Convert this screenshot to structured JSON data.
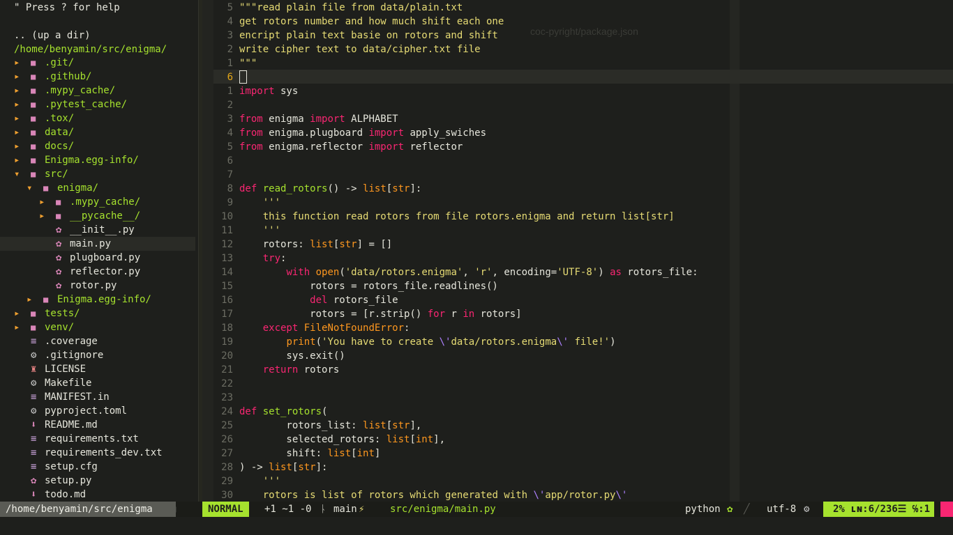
{
  "tree": {
    "help": "\" Press ? for help",
    "updir": ".. (up a dir)",
    "root": "/home/benyamin/src/enigma/",
    "items": [
      {
        "indent": 0,
        "kind": "dir",
        "arrow": "▸",
        "name": ".git/"
      },
      {
        "indent": 0,
        "kind": "dir",
        "arrow": "▸",
        "name": ".github/"
      },
      {
        "indent": 0,
        "kind": "dir",
        "arrow": "▸",
        "name": ".mypy_cache/"
      },
      {
        "indent": 0,
        "kind": "dir",
        "arrow": "▸",
        "name": ".pytest_cache/"
      },
      {
        "indent": 0,
        "kind": "dir",
        "arrow": "▸",
        "name": ".tox/"
      },
      {
        "indent": 0,
        "kind": "dir",
        "arrow": "▸",
        "name": "data/"
      },
      {
        "indent": 0,
        "kind": "dir",
        "arrow": "▸",
        "name": "docs/"
      },
      {
        "indent": 0,
        "kind": "dir",
        "arrow": "▸",
        "name": "Enigma.egg-info/"
      },
      {
        "indent": 0,
        "kind": "dir",
        "arrow": "▾",
        "name": "src/"
      },
      {
        "indent": 1,
        "kind": "dir",
        "arrow": "▾",
        "name": "enigma/"
      },
      {
        "indent": 2,
        "kind": "dir",
        "arrow": "▸",
        "name": ".mypy_cache/"
      },
      {
        "indent": 2,
        "kind": "dir",
        "arrow": "▸",
        "name": "__pycache__/"
      },
      {
        "indent": 2,
        "kind": "py",
        "name": "__init__.py"
      },
      {
        "indent": 2,
        "kind": "py",
        "name": "main.py",
        "current": true
      },
      {
        "indent": 2,
        "kind": "py",
        "name": "plugboard.py"
      },
      {
        "indent": 2,
        "kind": "py",
        "name": "reflector.py"
      },
      {
        "indent": 2,
        "kind": "py",
        "name": "rotor.py"
      },
      {
        "indent": 1,
        "kind": "dir",
        "arrow": "▸",
        "name": "Enigma.egg-info/"
      },
      {
        "indent": 0,
        "kind": "dir",
        "arrow": "▸",
        "name": "tests/"
      },
      {
        "indent": 0,
        "kind": "dir",
        "arrow": "▸",
        "name": "venv/"
      },
      {
        "indent": 0,
        "kind": "lines",
        "name": ".coverage"
      },
      {
        "indent": 0,
        "kind": "gear",
        "name": ".gitignore"
      },
      {
        "indent": 0,
        "kind": "person",
        "name": "LICENSE"
      },
      {
        "indent": 0,
        "kind": "gear",
        "name": "Makefile"
      },
      {
        "indent": 0,
        "kind": "lines",
        "name": "MANIFEST.in"
      },
      {
        "indent": 0,
        "kind": "gear",
        "name": "pyproject.toml"
      },
      {
        "indent": 0,
        "kind": "down",
        "name": "README.md"
      },
      {
        "indent": 0,
        "kind": "lines",
        "name": "requirements.txt"
      },
      {
        "indent": 0,
        "kind": "lines",
        "name": "requirements_dev.txt"
      },
      {
        "indent": 0,
        "kind": "lines",
        "name": "setup.cfg"
      },
      {
        "indent": 0,
        "kind": "py",
        "name": "setup.py"
      },
      {
        "indent": 0,
        "kind": "down",
        "name": "todo.md"
      }
    ]
  },
  "editor": {
    "lines": [
      {
        "n": "5",
        "tokens": [
          [
            "cm",
            "\"\"\"read plain file from data/plain.txt"
          ]
        ]
      },
      {
        "n": "4",
        "tokens": [
          [
            "cm",
            "get rotors number and how much shift each one"
          ]
        ]
      },
      {
        "n": "3",
        "tokens": [
          [
            "cm",
            "encript plain text basie on rotors and shift"
          ]
        ]
      },
      {
        "n": "2",
        "tokens": [
          [
            "cm",
            "write cipher text to data/cipher.txt file"
          ]
        ]
      },
      {
        "n": "1",
        "tokens": [
          [
            "cm",
            "\"\"\""
          ]
        ]
      },
      {
        "n": "6",
        "cur": true,
        "tokens": []
      },
      {
        "n": "1",
        "tokens": [
          [
            "kw",
            "import"
          ],
          [
            "pl",
            " sys"
          ]
        ]
      },
      {
        "n": "2",
        "tokens": []
      },
      {
        "n": "3",
        "tokens": [
          [
            "kw",
            "from"
          ],
          [
            "pl",
            " enigma "
          ],
          [
            "kw",
            "import"
          ],
          [
            "pl",
            " ALPHABET"
          ]
        ]
      },
      {
        "n": "4",
        "tokens": [
          [
            "kw",
            "from"
          ],
          [
            "pl",
            " enigma.plugboard "
          ],
          [
            "kw",
            "import"
          ],
          [
            "pl",
            " apply_swiches"
          ]
        ]
      },
      {
        "n": "5",
        "tokens": [
          [
            "kw",
            "from"
          ],
          [
            "pl",
            " enigma.reflector "
          ],
          [
            "kw",
            "import"
          ],
          [
            "pl",
            " reflector"
          ]
        ]
      },
      {
        "n": "6",
        "tokens": []
      },
      {
        "n": "7",
        "tokens": []
      },
      {
        "n": "8",
        "tokens": [
          [
            "kw",
            "def"
          ],
          [
            "pl",
            " "
          ],
          [
            "fn",
            "read_rotors"
          ],
          [
            "pl",
            "() -> "
          ],
          [
            "ty",
            "list"
          ],
          [
            "pl",
            "["
          ],
          [
            "ty",
            "str"
          ],
          [
            "pl",
            "]:"
          ]
        ]
      },
      {
        "n": "9",
        "tokens": [
          [
            "pl",
            "    "
          ],
          [
            "cm",
            "'''"
          ]
        ]
      },
      {
        "n": "10",
        "tokens": [
          [
            "pl",
            "    "
          ],
          [
            "cm",
            "this function read rotors from file rotors.enigma and return list[str]"
          ]
        ]
      },
      {
        "n": "11",
        "tokens": [
          [
            "pl",
            "    "
          ],
          [
            "cm",
            "'''"
          ]
        ]
      },
      {
        "n": "12",
        "tokens": [
          [
            "pl",
            "    rotors: "
          ],
          [
            "ty",
            "list"
          ],
          [
            "pl",
            "["
          ],
          [
            "ty",
            "str"
          ],
          [
            "pl",
            "] = []"
          ]
        ]
      },
      {
        "n": "13",
        "tokens": [
          [
            "pl",
            "    "
          ],
          [
            "kw",
            "try"
          ],
          [
            "pl",
            ":"
          ]
        ]
      },
      {
        "n": "14",
        "tokens": [
          [
            "pl",
            "        "
          ],
          [
            "kw",
            "with"
          ],
          [
            "pl",
            " "
          ],
          [
            "ty",
            "open"
          ],
          [
            "pl",
            "("
          ],
          [
            "str",
            "'data/rotors.enigma'"
          ],
          [
            "pl",
            ", "
          ],
          [
            "str",
            "'r'"
          ],
          [
            "pl",
            ", encoding="
          ],
          [
            "str",
            "'UTF-8'"
          ],
          [
            "pl",
            ") "
          ],
          [
            "kw",
            "as"
          ],
          [
            "pl",
            " rotors_file:"
          ]
        ]
      },
      {
        "n": "15",
        "tokens": [
          [
            "pl",
            "            rotors = rotors_file.readlines()"
          ]
        ]
      },
      {
        "n": "16",
        "tokens": [
          [
            "pl",
            "            "
          ],
          [
            "kw",
            "del"
          ],
          [
            "pl",
            " rotors_file"
          ]
        ]
      },
      {
        "n": "17",
        "tokens": [
          [
            "pl",
            "            rotors = [r.strip() "
          ],
          [
            "kw",
            "for"
          ],
          [
            "pl",
            " r "
          ],
          [
            "kw",
            "in"
          ],
          [
            "pl",
            " rotors]"
          ]
        ]
      },
      {
        "n": "18",
        "tokens": [
          [
            "pl",
            "    "
          ],
          [
            "kw",
            "except"
          ],
          [
            "pl",
            " "
          ],
          [
            "ty",
            "FileNotFoundError"
          ],
          [
            "pl",
            ":"
          ]
        ]
      },
      {
        "n": "19",
        "tokens": [
          [
            "pl",
            "        "
          ],
          [
            "ty",
            "print"
          ],
          [
            "pl",
            "("
          ],
          [
            "str",
            "'You have to create "
          ],
          [
            "esc",
            "\\'"
          ],
          [
            "str",
            "data/rotors.enigma"
          ],
          [
            "esc",
            "\\'"
          ],
          [
            "str",
            " file!'"
          ],
          [
            "pl",
            ")"
          ]
        ]
      },
      {
        "n": "20",
        "tokens": [
          [
            "pl",
            "        sys.exit()"
          ]
        ]
      },
      {
        "n": "21",
        "tokens": [
          [
            "pl",
            "    "
          ],
          [
            "kw",
            "return"
          ],
          [
            "pl",
            " rotors"
          ]
        ]
      },
      {
        "n": "22",
        "tokens": []
      },
      {
        "n": "23",
        "tokens": []
      },
      {
        "n": "24",
        "tokens": [
          [
            "kw",
            "def"
          ],
          [
            "pl",
            " "
          ],
          [
            "fn",
            "set_rotors"
          ],
          [
            "pl",
            "("
          ]
        ]
      },
      {
        "n": "25",
        "tokens": [
          [
            "pl",
            "        rotors_list: "
          ],
          [
            "ty",
            "list"
          ],
          [
            "pl",
            "["
          ],
          [
            "ty",
            "str"
          ],
          [
            "pl",
            "],"
          ]
        ]
      },
      {
        "n": "26",
        "tokens": [
          [
            "pl",
            "        selected_rotors: "
          ],
          [
            "ty",
            "list"
          ],
          [
            "pl",
            "["
          ],
          [
            "ty",
            "int"
          ],
          [
            "pl",
            "],"
          ]
        ]
      },
      {
        "n": "27",
        "tokens": [
          [
            "pl",
            "        shift: "
          ],
          [
            "ty",
            "list"
          ],
          [
            "pl",
            "["
          ],
          [
            "ty",
            "int"
          ],
          [
            "pl",
            "]"
          ]
        ]
      },
      {
        "n": "28",
        "tokens": [
          [
            "pl",
            ") -> "
          ],
          [
            "ty",
            "list"
          ],
          [
            "pl",
            "["
          ],
          [
            "ty",
            "str"
          ],
          [
            "pl",
            "]:"
          ]
        ]
      },
      {
        "n": "29",
        "tokens": [
          [
            "pl",
            "    "
          ],
          [
            "cm",
            "'''"
          ]
        ]
      },
      {
        "n": "30",
        "tokens": [
          [
            "pl",
            "    "
          ],
          [
            "cm",
            "rotors is list of rotors which generated with "
          ],
          [
            "esc",
            "\\'"
          ],
          [
            "cm",
            "app/rotor.py"
          ],
          [
            "esc",
            "\\'"
          ]
        ]
      }
    ]
  },
  "status": {
    "tree_path": "/home/benyamin/src/enigma",
    "mode": "NORMAL",
    "git_diff": "+1 ~1 -0",
    "branch_icon": "ᚿ",
    "branch": "main",
    "branch_flag": "⚡",
    "file": "src/enigma/main.py",
    "filetype": "python",
    "filetype_icon": "python-icon",
    "encoding": "utf-8",
    "percent": "2%",
    "position": "ʟɴ:6/236☰ ℅:1",
    "accent": "#a6e22e",
    "trail_color": "#f92672"
  }
}
